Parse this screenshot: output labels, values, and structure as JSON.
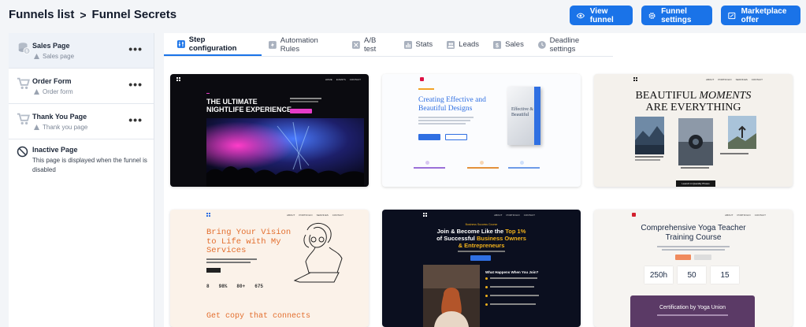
{
  "breadcrumb": {
    "parent": "Funnels list",
    "separator": ">",
    "current": "Funnel Secrets"
  },
  "header_buttons": {
    "view_funnel": "View funnel",
    "funnel_settings": "Funnel settings",
    "marketplace_offer": "Marketplace offer"
  },
  "sidebar": {
    "steps": [
      {
        "title": "Sales Page",
        "subtitle": "Sales page",
        "menu": "•••"
      },
      {
        "title": "Order Form",
        "subtitle": "Order form",
        "menu": "•••"
      },
      {
        "title": "Thank You Page",
        "subtitle": "Thank you page",
        "menu": "•••"
      }
    ],
    "inactive": {
      "title": "Inactive Page",
      "description": "This page is displayed when the funnel is disabled"
    }
  },
  "tabs": [
    "Step configuration",
    "Automation Rules",
    "A/B test",
    "Stats",
    "Leads",
    "Sales",
    "Deadline settings"
  ],
  "templates": {
    "t1": {
      "headline1": "THE ULTIMATE",
      "headline2": "NIGHTLIFE EXPERIENCE",
      "nav": [
        "HOME",
        "EVENTS",
        "CONTACT"
      ]
    },
    "t2": {
      "headline1": "Creating Effective and",
      "headline2": "Beautiful Designs",
      "book1": "Effective &",
      "book2": "Beautiful"
    },
    "t3": {
      "headline1": "BEAUTIFUL",
      "headline_em": "MOMENTS",
      "headline2": "ARE EVERYTHING",
      "nav": [
        "ABOUT",
        "PORTFOLIO",
        "SERVICES",
        "CONTACT"
      ],
      "cta": "Launch in Quantify Photos"
    },
    "t4": {
      "headline1": "Bring Your Vision",
      "headline2": "to Life with My",
      "headline3": "Services",
      "stats": [
        "8",
        "98%",
        "80+",
        "675"
      ],
      "bottom": "Get copy that connects",
      "nav": [
        "ABOUT",
        "PORTFOLIO",
        "SERVICES",
        "CONTACT"
      ]
    },
    "t5": {
      "eyebrow": "Business Success Course",
      "headline1": "Join & Become Like the ",
      "headline_hl": "Top 1%",
      "headline2": "of Successful ",
      "headline_hl2": "Business Owners",
      "headline3": "& Entrepreneurs",
      "section": "What Happens When You Join?",
      "nav": [
        "ABOUT",
        "PORTFOLIO",
        "CONTACT"
      ]
    },
    "t6": {
      "headline1": "Comprehensive Yoga Teacher",
      "headline2": "Training Course",
      "stats": [
        "250h",
        "50",
        "15"
      ],
      "cert": "Certification by Yoga Union",
      "nav": [
        "ABOUT",
        "PORTFOLIO",
        "CONTACT"
      ]
    }
  },
  "colors": {
    "accent": "#1a73e8",
    "nightlife_pink": "#e63cc8",
    "business_gold": "#f2b21b",
    "yoga_purple": "#5b3a66",
    "vision_orange": "#e36f2f"
  }
}
